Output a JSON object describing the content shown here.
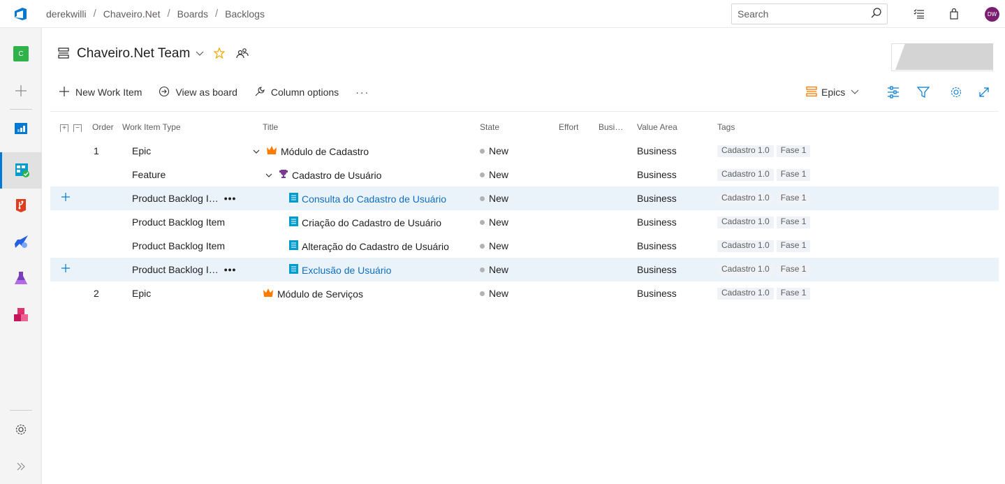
{
  "breadcrumb": [
    "derekwilli",
    "Chaveiro.Net",
    "Boards",
    "Backlogs"
  ],
  "search": {
    "placeholder": "Search"
  },
  "user": {
    "initials": "DW"
  },
  "project": {
    "initial": "C"
  },
  "team": {
    "title": "Chaveiro.Net Team"
  },
  "toolbar": {
    "new_work_item": "New Work Item",
    "view_as_board": "View as board",
    "column_options": "Column options",
    "more": "···",
    "level": "Epics"
  },
  "columns": {
    "order": "Order",
    "type": "Work Item Type",
    "title": "Title",
    "state": "State",
    "effort": "Effort",
    "business": "Busi…",
    "value_area": "Value Area",
    "tags": "Tags"
  },
  "rows": [
    {
      "order": "1",
      "type": "Epic",
      "title": "Módulo de Cadastro",
      "state": "New",
      "value_area": "Business",
      "tags": [
        "Cadastro 1.0",
        "Fase 1"
      ]
    },
    {
      "order": "",
      "type": "Feature",
      "title": "Cadastro de Usuário",
      "state": "New",
      "value_area": "Business",
      "tags": [
        "Cadastro 1.0",
        "Fase 1"
      ]
    },
    {
      "order": "",
      "type": "Product Backlog I…",
      "title": "Consulta do Cadastro de Usuário",
      "state": "New",
      "value_area": "Business",
      "tags": [
        "Cadastro 1.0",
        "Fase 1"
      ],
      "more": "•••"
    },
    {
      "order": "",
      "type": "Product Backlog Item",
      "title": "Criação do Cadastro de Usuário",
      "state": "New",
      "value_area": "Business",
      "tags": [
        "Cadastro 1.0",
        "Fase 1"
      ]
    },
    {
      "order": "",
      "type": "Product Backlog Item",
      "title": "Alteração do Cadastro de Usuário",
      "state": "New",
      "value_area": "Business",
      "tags": [
        "Cadastro 1.0",
        "Fase 1"
      ]
    },
    {
      "order": "",
      "type": "Product Backlog I…",
      "title": "Exclusão de Usuário",
      "state": "New",
      "value_area": "Business",
      "tags": [
        "Cadastro 1.0",
        "Fase 1"
      ],
      "more": "•••"
    },
    {
      "order": "2",
      "type": "Epic",
      "title": "Módulo de Serviços",
      "state": "New",
      "value_area": "Business",
      "tags": [
        "Cadastro 1.0",
        "Fase 1"
      ]
    }
  ],
  "colors": {
    "accent": "#0078d4",
    "epic": "#ff7b00",
    "feature": "#773b93",
    "pbi": "#009ccc",
    "link": "#106ebe"
  }
}
